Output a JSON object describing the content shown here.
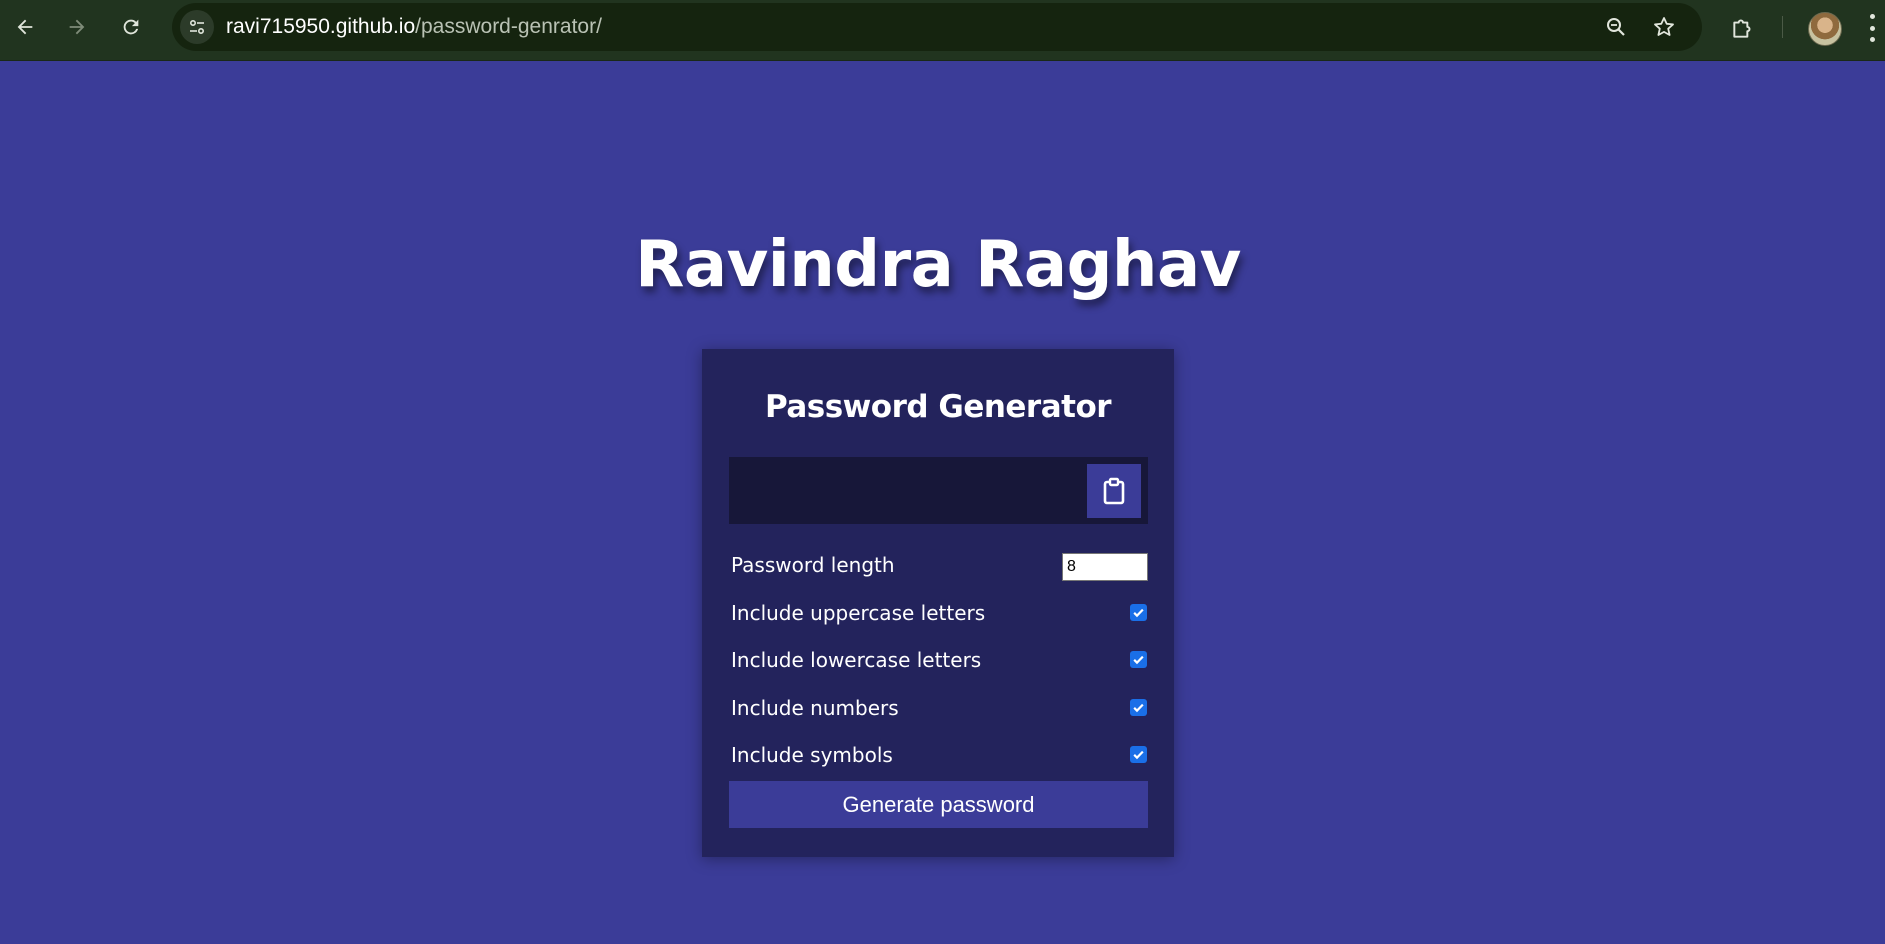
{
  "browser": {
    "url_domain": "ravi715950.github.io",
    "url_path": "/password-genrator/",
    "icons": {
      "back": "arrow-left-icon",
      "forward": "arrow-right-icon",
      "reload": "reload-icon",
      "site_info": "tune-icon",
      "zoom": "zoom-icon",
      "bookmark": "star-icon",
      "extensions": "puzzle-icon",
      "profile": "avatar",
      "menu": "kebab-menu-icon"
    },
    "colors": {
      "toolbar": "#21341f",
      "omnibox": "#15240f"
    }
  },
  "page": {
    "heading": "Ravindra Raghav",
    "background": "#3b3c98"
  },
  "generator": {
    "title": "Password Generator",
    "result_value": "",
    "clipboard_icon": "clipboard-icon",
    "length_label": "Password length",
    "length_value": "8",
    "options": [
      {
        "label": "Include uppercase letters",
        "checked": true
      },
      {
        "label": "Include lowercase letters",
        "checked": true
      },
      {
        "label": "Include numbers",
        "checked": true
      },
      {
        "label": "Include symbols",
        "checked": true
      }
    ],
    "generate_label": "Generate password",
    "colors": {
      "card": "#23235c",
      "result_bg": "#171739",
      "accent": "#3b3c98",
      "checkbox": "#1a6fe8"
    }
  }
}
